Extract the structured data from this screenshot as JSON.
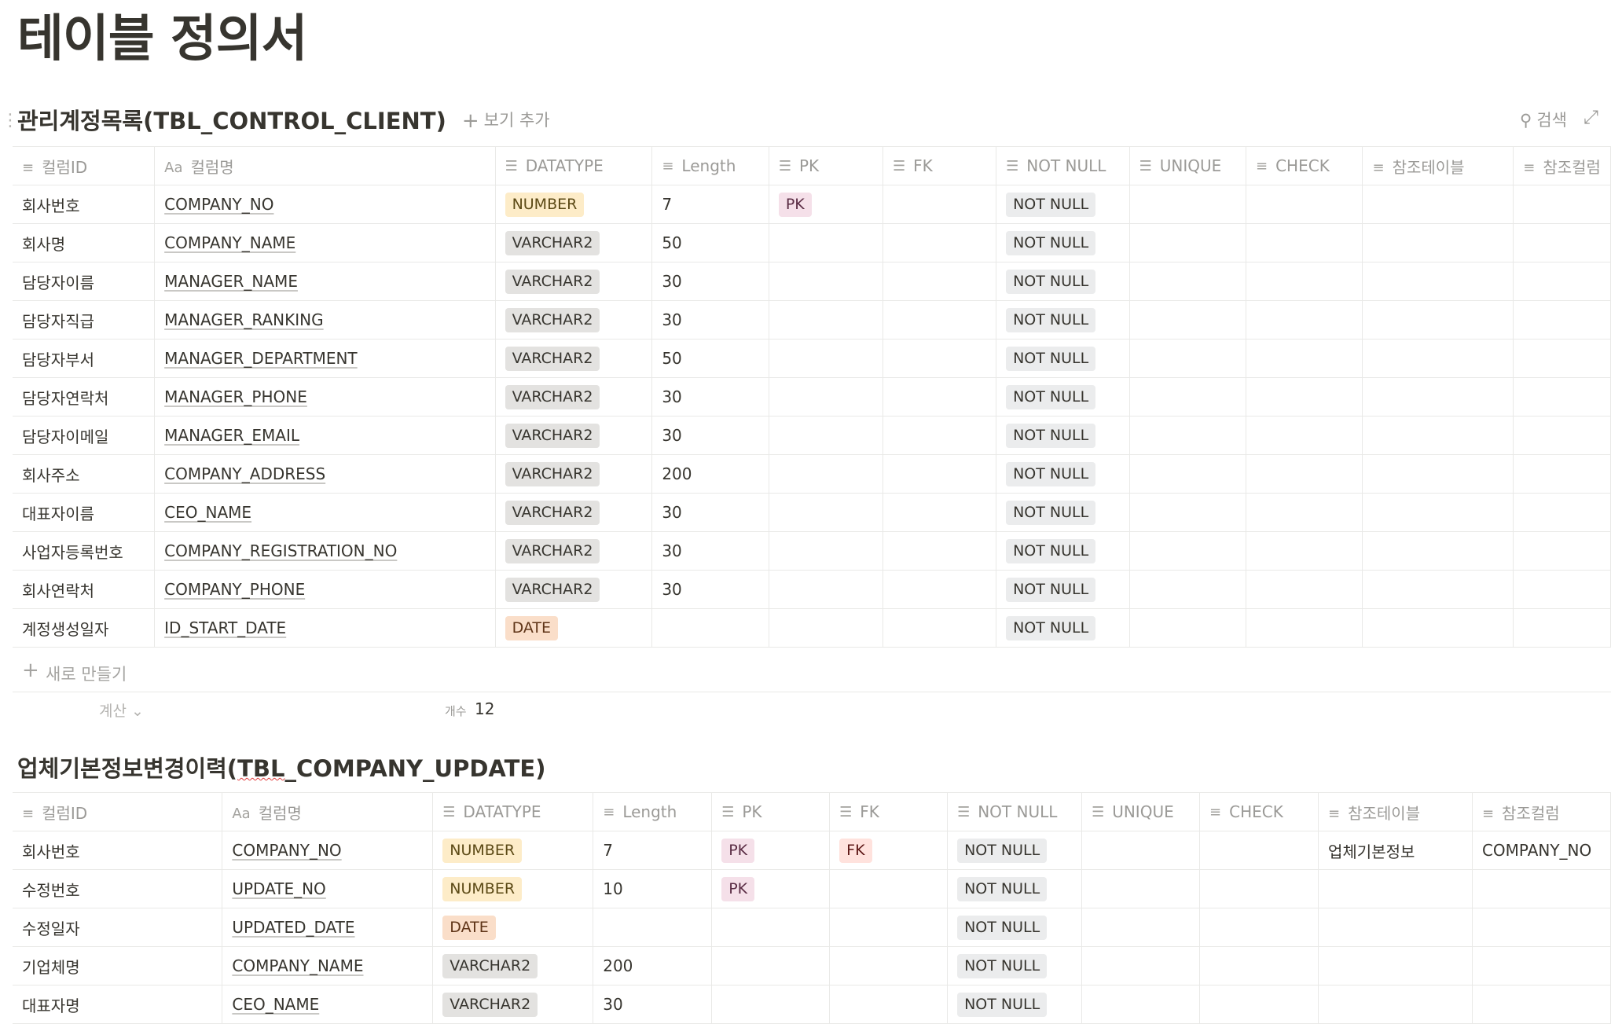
{
  "page": {
    "title": "테이블 정의서"
  },
  "views": {
    "add_view_label": "보기 추가",
    "search_label": "검색",
    "new_row_label": "새로 만들기",
    "calc_label": "계산",
    "count_label": "개수"
  },
  "db1": {
    "title": "관리계정목록(TBL_CONTROL_CLIENT)",
    "columns": [
      "컬럼ID",
      "컬럼명",
      "DATATYPE",
      "Length",
      "PK",
      "FK",
      "NOT NULL",
      "UNIQUE",
      "CHECK",
      "참조테이블",
      "참조컬럼"
    ],
    "count": "12",
    "rows": [
      {
        "id": "회사번호",
        "name": "COMPANY_NO",
        "type": "NUMBER",
        "length": "7",
        "pk": "PK",
        "fk": "",
        "nn": "NOT NULL"
      },
      {
        "id": "회사명",
        "name": "COMPANY_NAME",
        "type": "VARCHAR2",
        "length": "50",
        "pk": "",
        "fk": "",
        "nn": "NOT NULL"
      },
      {
        "id": "담당자이름",
        "name": "MANAGER_NAME",
        "type": "VARCHAR2",
        "length": "30",
        "pk": "",
        "fk": "",
        "nn": "NOT NULL"
      },
      {
        "id": "담당자직급",
        "name": "MANAGER_RANKING",
        "type": "VARCHAR2",
        "length": "30",
        "pk": "",
        "fk": "",
        "nn": "NOT NULL"
      },
      {
        "id": "담당자부서",
        "name": "MANAGER_DEPARTMENT",
        "type": "VARCHAR2",
        "length": "50",
        "pk": "",
        "fk": "",
        "nn": "NOT NULL"
      },
      {
        "id": "담당자연락처",
        "name": "MANAGER_PHONE",
        "type": "VARCHAR2",
        "length": "30",
        "pk": "",
        "fk": "",
        "nn": "NOT NULL"
      },
      {
        "id": "담당자이메일",
        "name": "MANAGER_EMAIL",
        "type": "VARCHAR2",
        "length": "30",
        "pk": "",
        "fk": "",
        "nn": "NOT NULL"
      },
      {
        "id": "회사주소",
        "name": "COMPANY_ADDRESS",
        "type": "VARCHAR2",
        "length": "200",
        "pk": "",
        "fk": "",
        "nn": "NOT NULL"
      },
      {
        "id": "대표자이름",
        "name": "CEO_NAME",
        "type": "VARCHAR2",
        "length": "30",
        "pk": "",
        "fk": "",
        "nn": "NOT NULL"
      },
      {
        "id": "사업자등록번호",
        "name": "COMPANY_REGISTRATION_NO",
        "type": "VARCHAR2",
        "length": "30",
        "pk": "",
        "fk": "",
        "nn": "NOT NULL"
      },
      {
        "id": "회사연락처",
        "name": "COMPANY_PHONE",
        "type": "VARCHAR2",
        "length": "30",
        "pk": "",
        "fk": "",
        "nn": "NOT NULL"
      },
      {
        "id": "계정생성일자",
        "name": "ID_START_DATE",
        "type": "DATE",
        "length": "",
        "pk": "",
        "fk": "",
        "nn": "NOT NULL"
      }
    ]
  },
  "db2": {
    "title_main": "업체기본정보변경이력(",
    "title_squiggle": "TBL",
    "title_rest": "_COMPANY_UPDATE)",
    "columns": [
      "컬럼ID",
      "컬럼명",
      "DATATYPE",
      "Length",
      "PK",
      "FK",
      "NOT NULL",
      "UNIQUE",
      "CHECK",
      "참조테이블",
      "참조컬럼"
    ],
    "rows": [
      {
        "id": "회사번호",
        "name": "COMPANY_NO",
        "type": "NUMBER",
        "length": "7",
        "pk": "PK",
        "fk": "FK",
        "nn": "NOT NULL",
        "ref_table": "업체기본정보",
        "ref_col": "COMPANY_NO"
      },
      {
        "id": "수정번호",
        "name": "UPDATE_NO",
        "type": "NUMBER",
        "length": "10",
        "pk": "PK",
        "fk": "",
        "nn": "NOT NULL",
        "ref_table": "",
        "ref_col": ""
      },
      {
        "id": "수정일자",
        "name": "UPDATED_DATE",
        "type": "DATE",
        "length": "",
        "pk": "",
        "fk": "",
        "nn": "NOT NULL",
        "ref_table": "",
        "ref_col": ""
      },
      {
        "id": "기업체명",
        "name": "COMPANY_NAME",
        "type": "VARCHAR2",
        "length": "200",
        "pk": "",
        "fk": "",
        "nn": "NOT NULL",
        "ref_table": "",
        "ref_col": ""
      },
      {
        "id": "대표자명",
        "name": "CEO_NAME",
        "type": "VARCHAR2",
        "length": "30",
        "pk": "",
        "fk": "",
        "nn": "NOT NULL",
        "ref_table": "",
        "ref_col": ""
      }
    ]
  }
}
